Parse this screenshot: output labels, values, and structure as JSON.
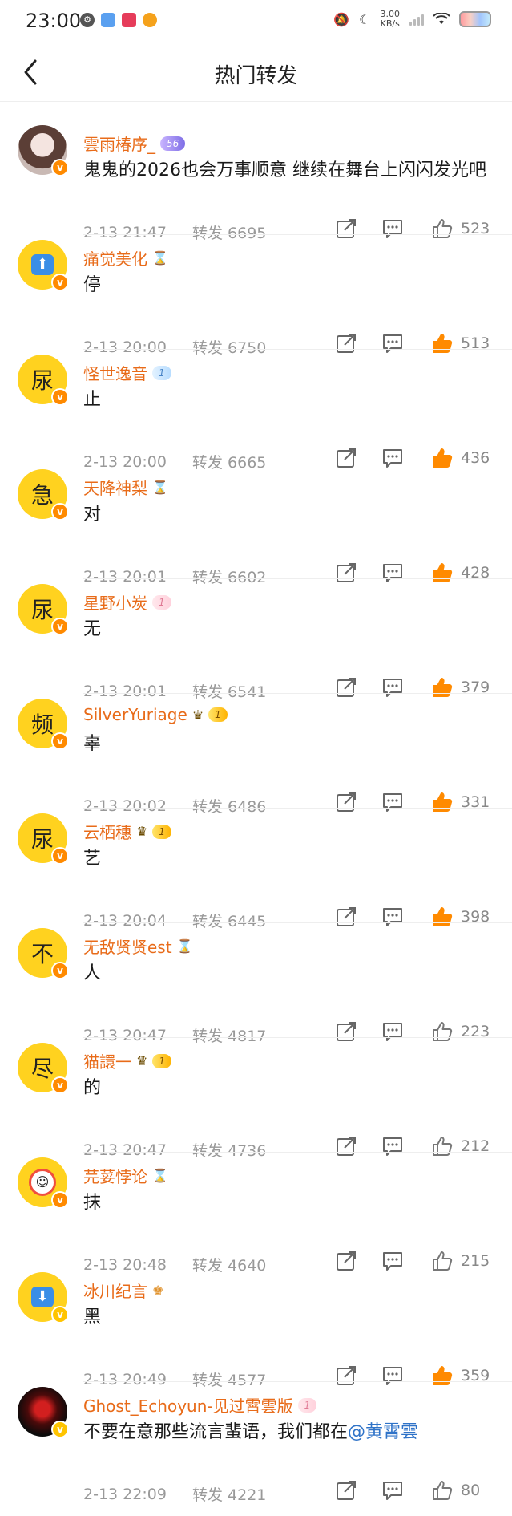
{
  "status_bar": {
    "time": "23:00",
    "speed_value": "3.00",
    "speed_unit": "KB/s",
    "icons": [
      "gear-icon",
      "app-icon",
      "app-icon",
      "weibo-icon"
    ]
  },
  "nav": {
    "title": "热门转发",
    "back_icon": "chevron-left-icon"
  },
  "colors": {
    "username": "#e86b19",
    "meta": "#999999",
    "like_active": "#ff8a00",
    "like_inactive": "#888888",
    "mention": "#2f73c8"
  },
  "reposts": [
    {
      "username": "雲雨椿序_",
      "medal": "56",
      "content": "鬼鬼的2026也会万事顺意 继续在舞台上闪闪发光吧",
      "time": "2-13 21:47",
      "forward": "转发 6695",
      "likes": "523",
      "liked": false,
      "avatar_icon": "photo-avatar"
    },
    {
      "username": "痛觉美化",
      "content": "停",
      "time": "2-13 20:00",
      "forward": "转发 6750",
      "likes": "513",
      "liked": true,
      "avatar_icon": "up-arrow-icon"
    },
    {
      "username": "怪世逸音",
      "medal": "1",
      "content": "止",
      "time": "2-13 20:00",
      "forward": "转发 6665",
      "likes": "436",
      "liked": true,
      "avatar_char": "尿"
    },
    {
      "username": "天降神梨",
      "content": "对",
      "time": "2-13 20:01",
      "forward": "转发 6602",
      "likes": "428",
      "liked": true,
      "avatar_char": "急"
    },
    {
      "username": "星野小炭",
      "medal": "1",
      "content": "无",
      "time": "2-13 20:01",
      "forward": "转发 6541",
      "likes": "379",
      "liked": true,
      "avatar_char": "尿"
    },
    {
      "username": "SilverYuriage",
      "medal": "1",
      "content": "辜",
      "time": "2-13 20:02",
      "forward": "转发 6486",
      "likes": "331",
      "liked": true,
      "avatar_char": "频"
    },
    {
      "username": "云栖穗",
      "medal": "1",
      "content": "艺",
      "time": "2-13 20:04",
      "forward": "转发 6445",
      "likes": "398",
      "liked": true,
      "avatar_char": "尿"
    },
    {
      "username": "无敌贤贤est",
      "content": "人",
      "time": "2-13 20:47",
      "forward": "转发 4817",
      "likes": "223",
      "liked": false,
      "avatar_char": "不"
    },
    {
      "username": "猫譞一",
      "medal": "1",
      "content": "的",
      "time": "2-13 20:47",
      "forward": "转发 4736",
      "likes": "212",
      "liked": false,
      "avatar_char": "尽"
    },
    {
      "username": "芫荽悖论",
      "content": "抹",
      "time": "2-13 20:48",
      "forward": "转发 4640",
      "likes": "215",
      "liked": false,
      "avatar_icon": "clown-icon"
    },
    {
      "username": "冰川纪言",
      "content": "黑",
      "time": "2-13 20:49",
      "forward": "转发 4577",
      "likes": "359",
      "liked": true,
      "avatar_icon": "down-arrow-icon"
    },
    {
      "username": "Ghost_Echoyun-见过霄雲版",
      "medal": "1",
      "content": "不要在意那些流言蜚语，我们都在",
      "mention": "@黄霄雲",
      "time": "2-13 22:09",
      "forward": "转发 4221",
      "likes": "80",
      "liked": false,
      "avatar_icon": "dark-photo-avatar"
    }
  ]
}
